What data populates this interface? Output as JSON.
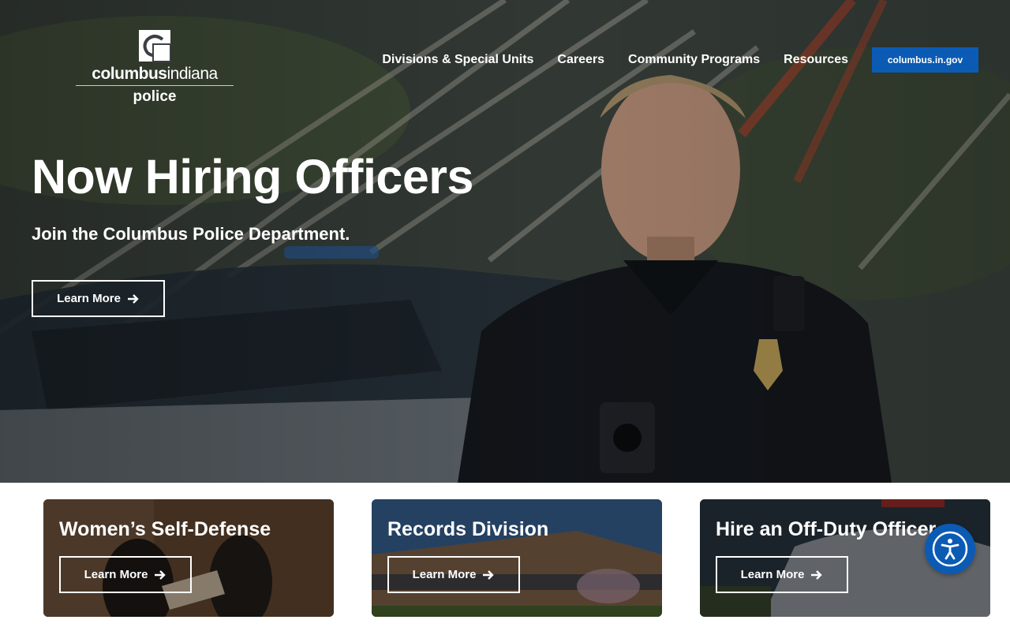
{
  "header": {
    "logo": {
      "word_bold": "columbus",
      "word_thin": "indiana",
      "sub": "police"
    },
    "nav": [
      {
        "label": "Divisions & Special Units"
      },
      {
        "label": "Careers"
      },
      {
        "label": "Community Programs"
      },
      {
        "label": "Resources"
      }
    ],
    "cta_label": "columbus.in.gov"
  },
  "hero": {
    "title": "Now Hiring Officers",
    "subtitle": "Join the Columbus Police Department.",
    "button_label": "Learn More"
  },
  "cards": [
    {
      "title": "Women’s Self-Defense",
      "button_label": "Learn More"
    },
    {
      "title": "Records Division",
      "button_label": "Learn More"
    },
    {
      "title": "Hire an Off-Duty Officer",
      "button_label": "Learn More"
    }
  ],
  "icons": {
    "arrow": "arrow-right-icon",
    "accessibility": "accessibility-icon",
    "logo": "columbus-logo-mark"
  },
  "colors": {
    "accent": "#0b5bb5",
    "text_on_dark": "#ffffff"
  }
}
